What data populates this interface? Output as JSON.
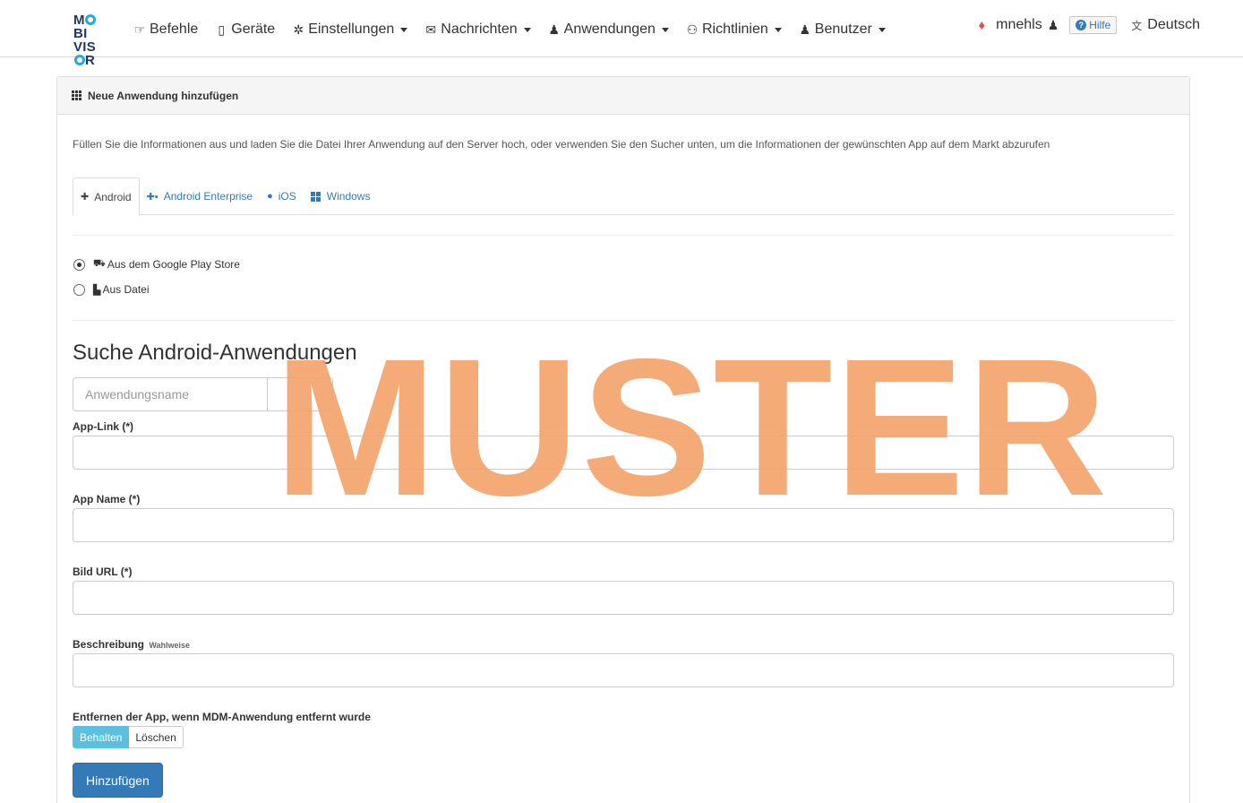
{
  "logo": {
    "line1_a": "M",
    "line1_b": "BI",
    "line2_a": "VIS",
    "line2_b": "R"
  },
  "nav": {
    "items": [
      {
        "label": "Befehle",
        "icon": "hand-pointer-icon",
        "dropdown": false
      },
      {
        "label": "Geräte",
        "icon": "mobile-icon",
        "dropdown": false
      },
      {
        "label": "Einstellungen",
        "icon": "gear-icon",
        "dropdown": true
      },
      {
        "label": "Nachrichten",
        "icon": "envelope-icon",
        "dropdown": true
      },
      {
        "label": "Anwendungen",
        "icon": "app-user-icon",
        "dropdown": true
      },
      {
        "label": "Richtlinien",
        "icon": "users-icon",
        "dropdown": true
      },
      {
        "label": "Benutzer",
        "icon": "user-icon",
        "dropdown": true
      }
    ],
    "username": "mnehls",
    "help_label": "Hilfe",
    "language": "Deutsch"
  },
  "panel": {
    "title": "Neue Anwendung hinzufügen",
    "intro": "Füllen Sie die Informationen aus und laden Sie die Datei Ihrer Anwendung auf den Server hoch, oder verwenden Sie den Sucher unten, um die Informationen der gewünschten App auf dem Markt abzurufen",
    "tabs": [
      {
        "label": "Android",
        "active": true,
        "icon": "android-icon"
      },
      {
        "label": "Android Enterprise",
        "active": false,
        "icon": "android-enterprise-icon"
      },
      {
        "label": "iOS",
        "active": false,
        "icon": "apple-icon"
      },
      {
        "label": "Windows",
        "active": false,
        "icon": "windows-icon"
      }
    ],
    "source_options": [
      {
        "label": "Aus dem Google Play Store",
        "checked": true,
        "icon": "cart-icon"
      },
      {
        "label": "Aus Datei",
        "checked": false,
        "icon": "file-icon"
      }
    ],
    "search": {
      "title": "Suche Android-Anwendungen",
      "placeholder": "Anwendungsname"
    },
    "fields": [
      {
        "label": "App-Link (*)",
        "value": ""
      },
      {
        "label": "App Name (*)",
        "value": ""
      },
      {
        "label": "Bild URL (*)",
        "value": ""
      },
      {
        "label": "Beschreibung",
        "optional": "Wahlweise",
        "value": ""
      }
    ],
    "remove_app": {
      "label": "Entfernen der App, wenn MDM-Anwendung entfernt wurde",
      "options": [
        "Behalten",
        "Löschen"
      ],
      "selected": "Behalten"
    },
    "submit_label": "Hinzufügen"
  },
  "watermark": "MUSTER",
  "colors": {
    "primary": "#337ab7",
    "info": "#5bc0de",
    "watermark": "#f4a46c",
    "bell": "#d9534f"
  }
}
